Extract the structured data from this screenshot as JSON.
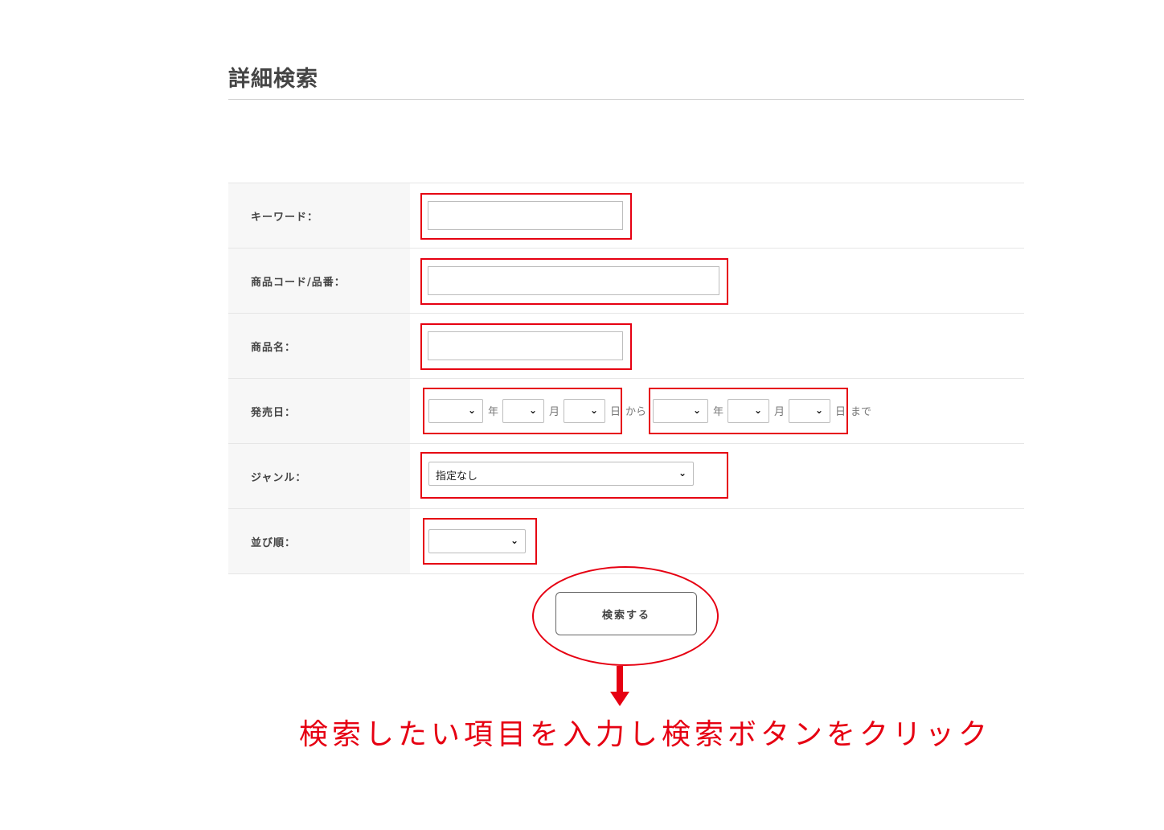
{
  "page": {
    "title": "詳細検索"
  },
  "form": {
    "keyword_label": "キーワード：",
    "product_code_label": "商品コード/品番：",
    "product_name_label": "商品名：",
    "release_date_label": "発売日：",
    "genre_label": "ジャンル：",
    "sort_label": "並び順：",
    "year_unit": "年",
    "month_unit": "月",
    "day_unit": "日",
    "from_text": "から",
    "until_text": "まで",
    "genre_selected": "指定なし",
    "keyword_value": "",
    "product_code_value": "",
    "product_name_value": ""
  },
  "search_button_label": "検索する",
  "annotation": {
    "instruction": "検索したい項目を入力し検索ボタンをクリック",
    "highlight_color": "#e60012"
  },
  "icons": {
    "select_chevron": "chevron-down-icon",
    "arrow": "arrow-down-icon"
  }
}
